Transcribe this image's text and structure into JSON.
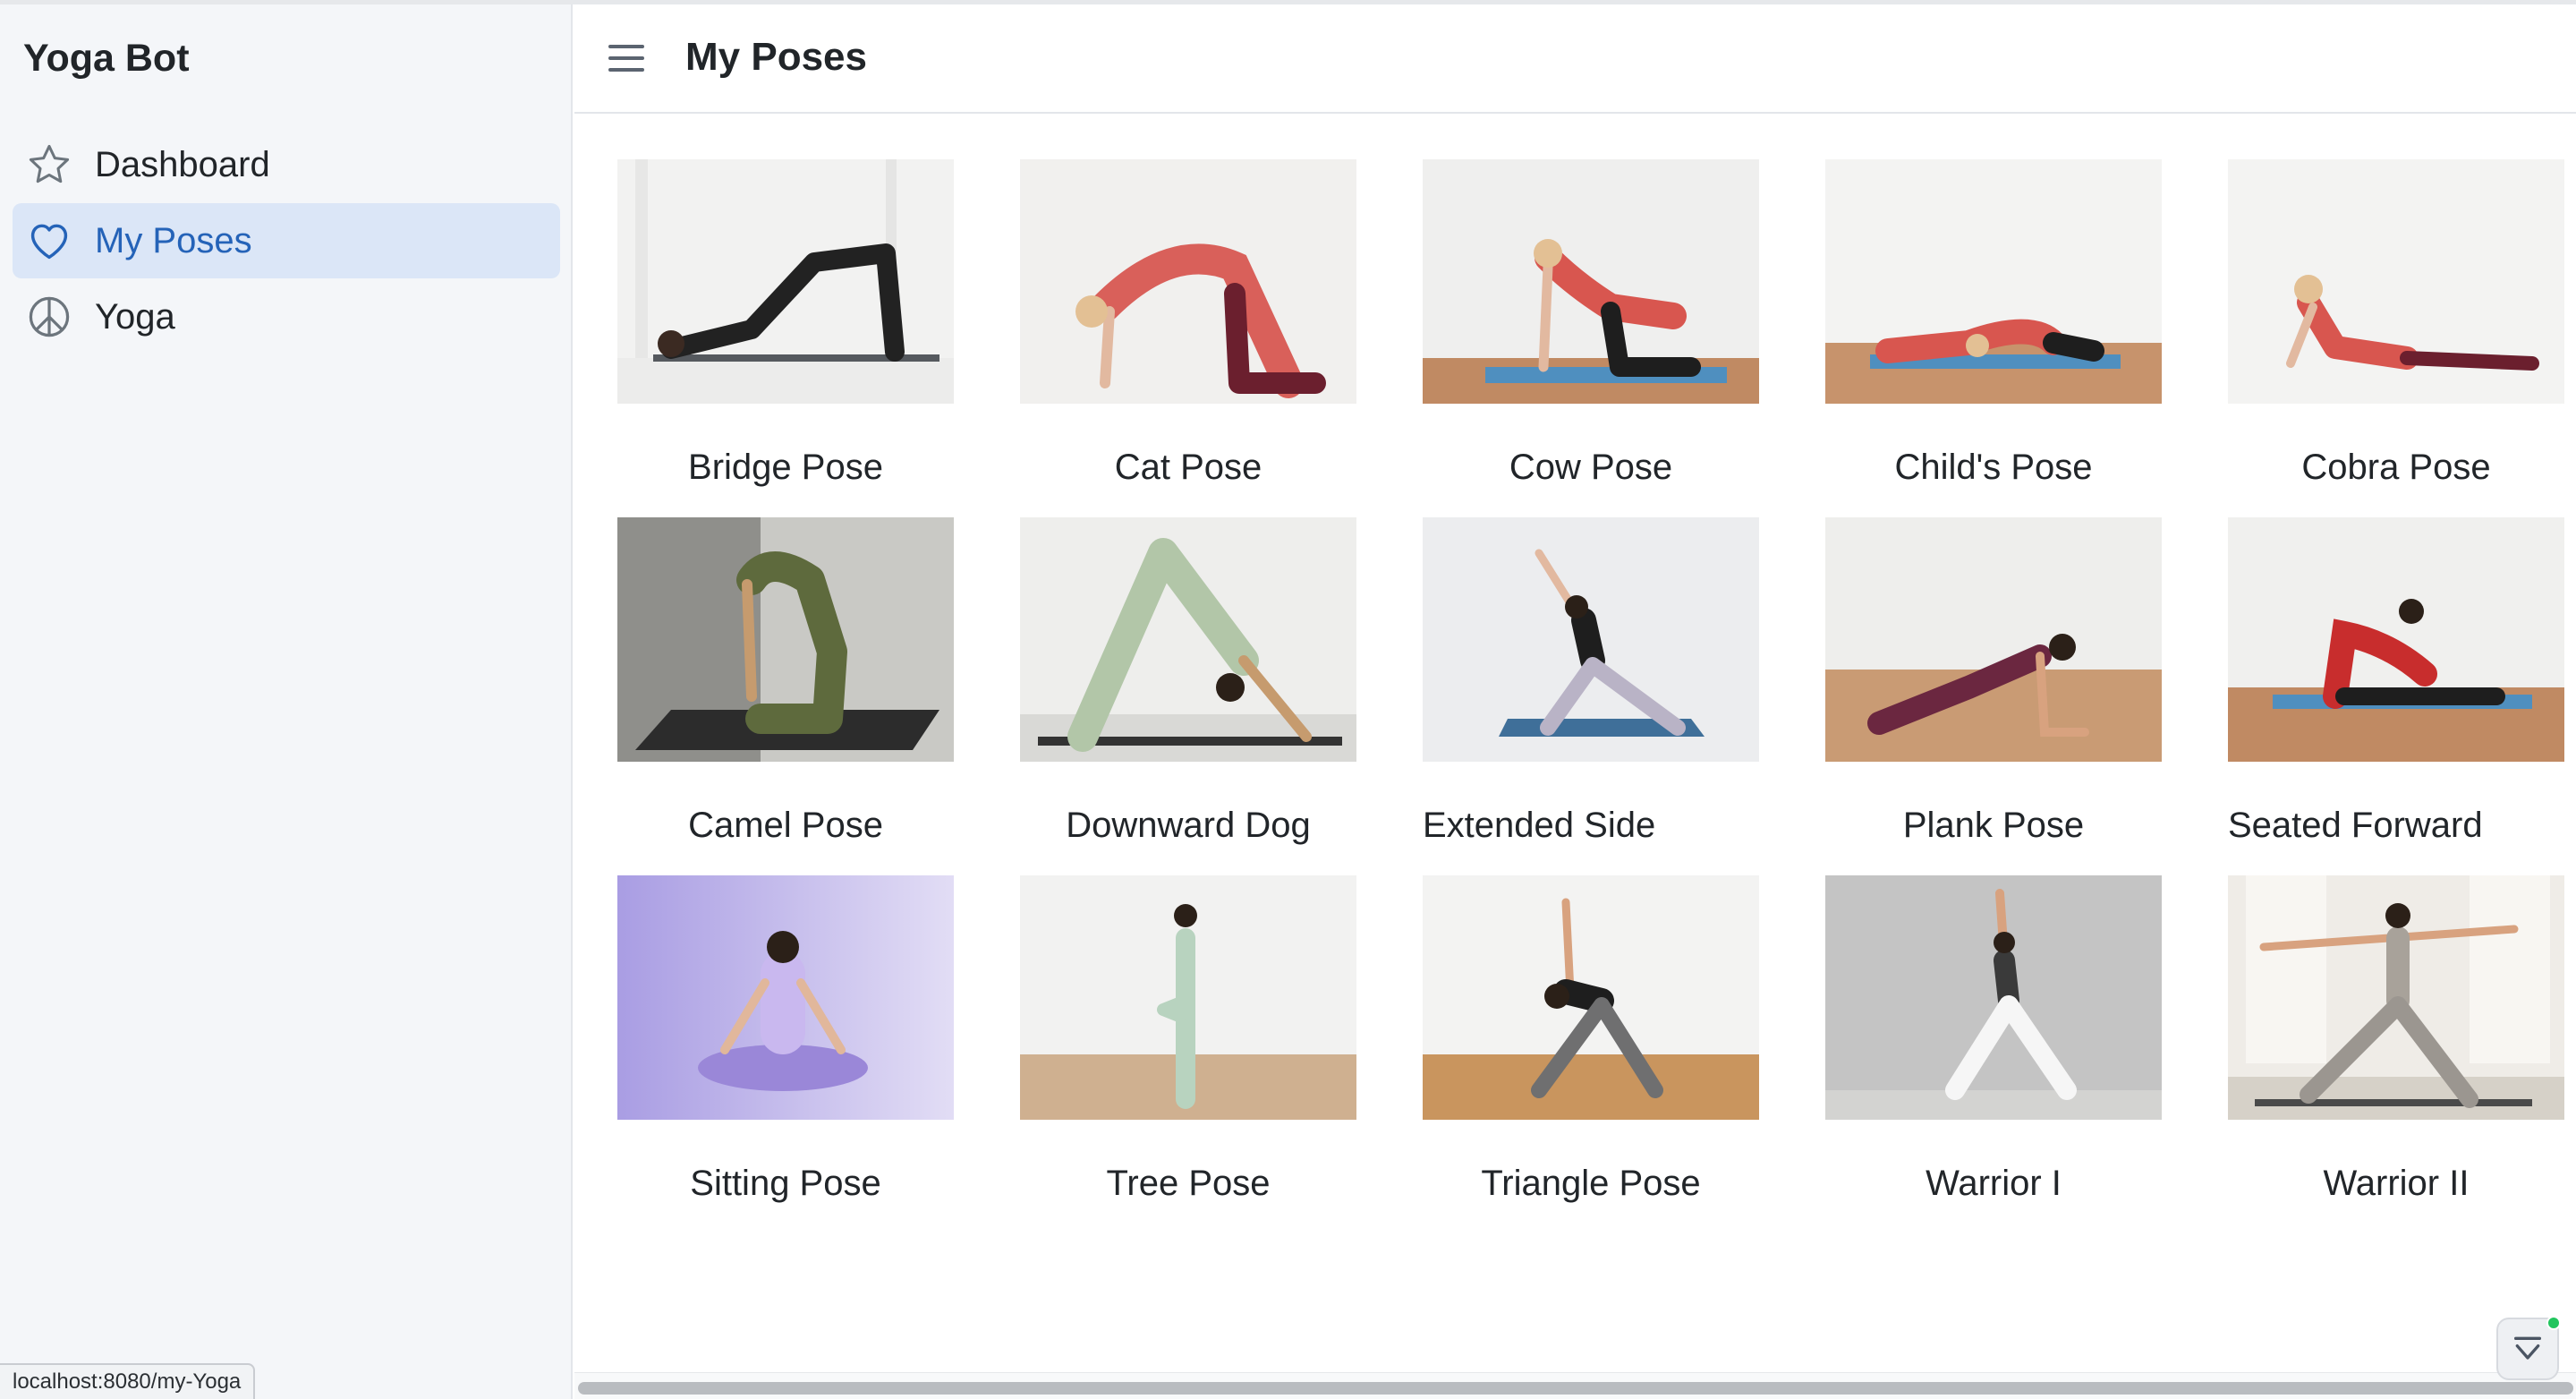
{
  "app": {
    "brand": "Yoga Bot"
  },
  "sidebar": {
    "items": [
      {
        "label": "Dashboard",
        "icon": "star-icon",
        "active": false
      },
      {
        "label": "My Poses",
        "icon": "heart-icon",
        "active": true
      },
      {
        "label": "Yoga",
        "icon": "peace-icon",
        "active": false
      }
    ]
  },
  "header": {
    "title": "My Poses"
  },
  "status_bar": {
    "url": "localhost:8080/my-Yoga"
  },
  "poses": [
    {
      "name": "Bridge Pose"
    },
    {
      "name": "Cat Pose"
    },
    {
      "name": "Cow Pose"
    },
    {
      "name": "Child's Pose"
    },
    {
      "name": "Cobra Pose"
    },
    {
      "name": "Camel Pose"
    },
    {
      "name": "Downward Dog"
    },
    {
      "name": "Extended Side"
    },
    {
      "name": "Plank Pose"
    },
    {
      "name": "Seated Forward"
    },
    {
      "name": "Sitting Pose"
    },
    {
      "name": "Tree Pose"
    },
    {
      "name": "Triangle Pose"
    },
    {
      "name": "Warrior I"
    },
    {
      "name": "Warrior II"
    }
  ],
  "colors": {
    "accent": "#2563b8",
    "active_bg": "#dbe6f7",
    "sidebar_bg": "#f4f6f9",
    "status_dot": "#22c55e"
  }
}
